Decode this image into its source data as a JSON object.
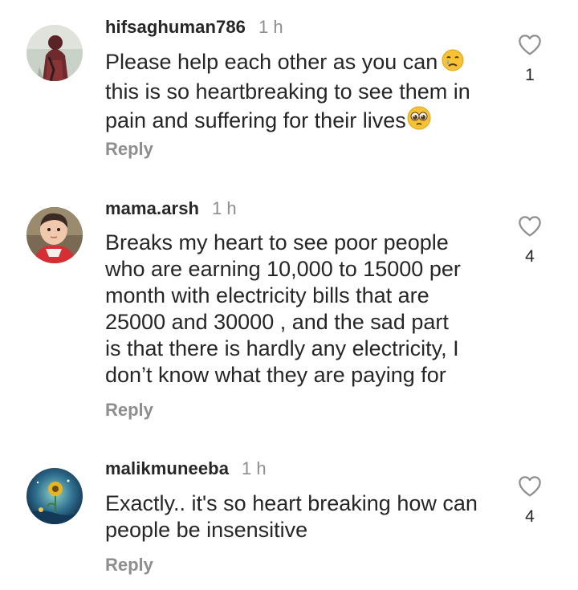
{
  "comments": [
    {
      "username": "hifsaghuman786",
      "time": "1 h",
      "text_lines": [
        "Please help each other as you can",
        "this is so heartbreaking to see them in",
        "pain and suffering for their lives"
      ],
      "inline_emojis": [
        "crying-face-emoji",
        "pleading-face-emoji"
      ],
      "reply_label": "Reply",
      "like_count": "1",
      "like_icon": "heart-outline-icon",
      "avatar": "user-avatar"
    },
    {
      "username": "mama.arsh",
      "time": "1 h",
      "text_lines": [
        "Breaks my heart to see poor people",
        "who are earning 10,000 to 15000 per",
        "month with electricity bills that are",
        "25000 and 30000 , and the sad part",
        "is that there is hardly any electricity, I",
        "don’t know what they are paying for"
      ],
      "reply_label": "Reply",
      "like_count": "4",
      "like_icon": "heart-outline-icon",
      "avatar": "user-avatar"
    },
    {
      "username": "malikmuneeba",
      "time": "1 h",
      "text_lines": [
        "Exactly.. it's so heart breaking how can",
        "people be insensitive"
      ],
      "reply_label": "Reply",
      "like_count": "4",
      "like_icon": "heart-outline-icon",
      "avatar": "user-avatar"
    }
  ],
  "colors": {
    "text": "#262626",
    "secondary": "#8e8e8e",
    "background": "#ffffff"
  }
}
